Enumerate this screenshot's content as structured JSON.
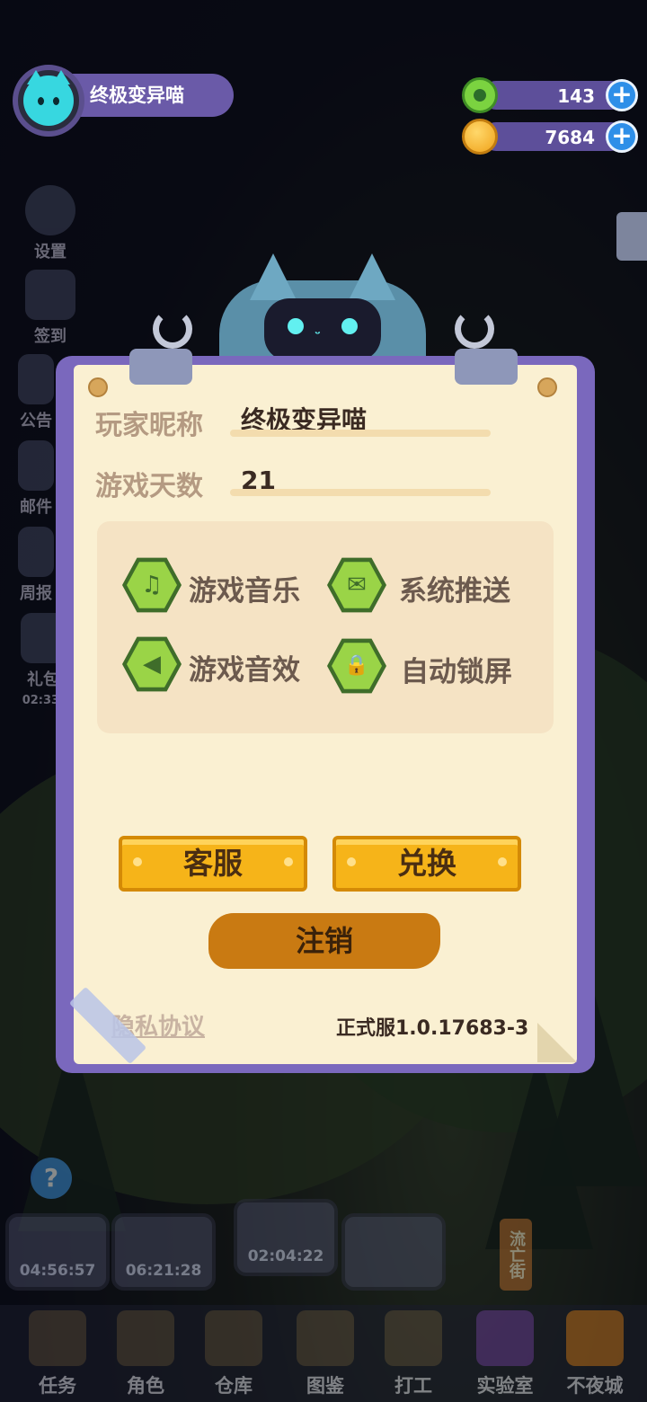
{
  "player": {
    "name": "终极变异喵"
  },
  "currencies": [
    {
      "icon": "donut-icon",
      "amount": "143",
      "plus": "+"
    },
    {
      "icon": "planet-coin-icon",
      "amount": "7684",
      "plus": "+"
    }
  ],
  "side_menu": {
    "items": [
      {
        "label": "设置"
      },
      {
        "label": "签到"
      },
      {
        "label": "公告"
      },
      {
        "label": "邮件"
      },
      {
        "label": "周报"
      },
      {
        "label": "礼包",
        "timer": "02:33:"
      }
    ]
  },
  "dialog": {
    "nickname_label": "玩家昵称",
    "nickname_value": "终极变异喵",
    "days_label": "游戏天数",
    "days_value": "21",
    "toggles": [
      {
        "label": "游戏音乐",
        "icon": "music-note-icon",
        "glyph": "♫"
      },
      {
        "label": "系统推送",
        "icon": "envelope-icon",
        "glyph": "✉"
      },
      {
        "label": "游戏音效",
        "icon": "speaker-icon",
        "glyph": "◀"
      },
      {
        "label": "自动锁屏",
        "icon": "lock-icon",
        "glyph": "🔒"
      }
    ],
    "customer_service_label": "客服",
    "redeem_label": "兑换",
    "logout_label": "注销",
    "privacy_label": "隐私协议",
    "version": "正式服1.0.17683-3"
  },
  "timers": [
    "04:56:57",
    "06:21:28",
    "02:04:22"
  ],
  "street_sign": "流亡街",
  "help": "?",
  "bottom_nav": [
    {
      "label": "任务"
    },
    {
      "label": "角色"
    },
    {
      "label": "仓库"
    },
    {
      "label": "图鉴"
    },
    {
      "label": "打工"
    },
    {
      "label": "实验室"
    },
    {
      "label": "不夜城"
    }
  ]
}
